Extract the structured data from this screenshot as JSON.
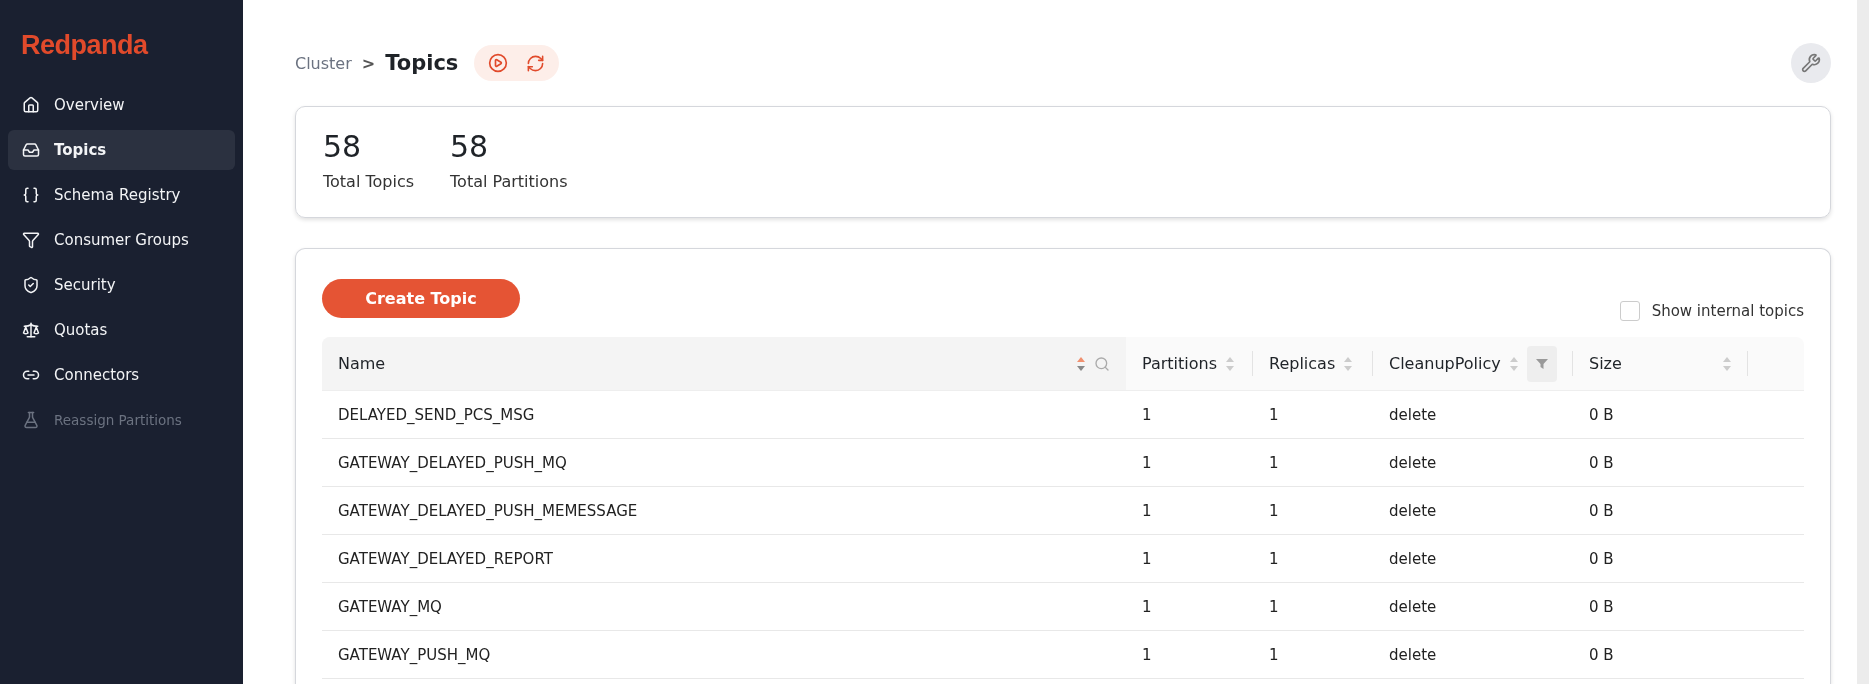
{
  "sidebar": {
    "logo": "Redpanda",
    "items": [
      {
        "label": "Overview",
        "selected": false,
        "disabled": false
      },
      {
        "label": "Topics",
        "selected": true,
        "disabled": false
      },
      {
        "label": "Schema Registry",
        "selected": false,
        "disabled": false
      },
      {
        "label": "Consumer Groups",
        "selected": false,
        "disabled": false
      },
      {
        "label": "Security",
        "selected": false,
        "disabled": false
      },
      {
        "label": "Quotas",
        "selected": false,
        "disabled": false
      },
      {
        "label": "Connectors",
        "selected": false,
        "disabled": false
      },
      {
        "label": "Reassign Partitions",
        "selected": false,
        "disabled": true
      }
    ]
  },
  "breadcrumb": {
    "parent": "Cluster",
    "separator": ">",
    "current": "Topics"
  },
  "stats": [
    {
      "value": "58",
      "label": "Total Topics"
    },
    {
      "value": "58",
      "label": "Total Partitions"
    }
  ],
  "create_button": "Create Topic",
  "show_internal": {
    "label": "Show internal topics",
    "checked": false
  },
  "table": {
    "columns": [
      {
        "label": "Name",
        "sortable": true,
        "search": true,
        "filter": false
      },
      {
        "label": "Partitions",
        "sortable": true,
        "search": false,
        "filter": false
      },
      {
        "label": "Replicas",
        "sortable": true,
        "search": false,
        "filter": false
      },
      {
        "label": "CleanupPolicy",
        "sortable": true,
        "search": false,
        "filter": true
      },
      {
        "label": "Size",
        "sortable": true,
        "search": false,
        "filter": false
      }
    ],
    "rows": [
      [
        "DELAYED_SEND_PCS_MSG",
        "1",
        "1",
        "delete",
        "0 B"
      ],
      [
        "GATEWAY_DELAYED_PUSH_MQ",
        "1",
        "1",
        "delete",
        "0 B"
      ],
      [
        "GATEWAY_DELAYED_PUSH_MEMESSAGE",
        "1",
        "1",
        "delete",
        "0 B"
      ],
      [
        "GATEWAY_DELAYED_REPORT",
        "1",
        "1",
        "delete",
        "0 B"
      ],
      [
        "GATEWAY_MQ",
        "1",
        "1",
        "delete",
        "0 B"
      ],
      [
        "GATEWAY_PUSH_MQ",
        "1",
        "1",
        "delete",
        "0 B"
      ]
    ]
  }
}
